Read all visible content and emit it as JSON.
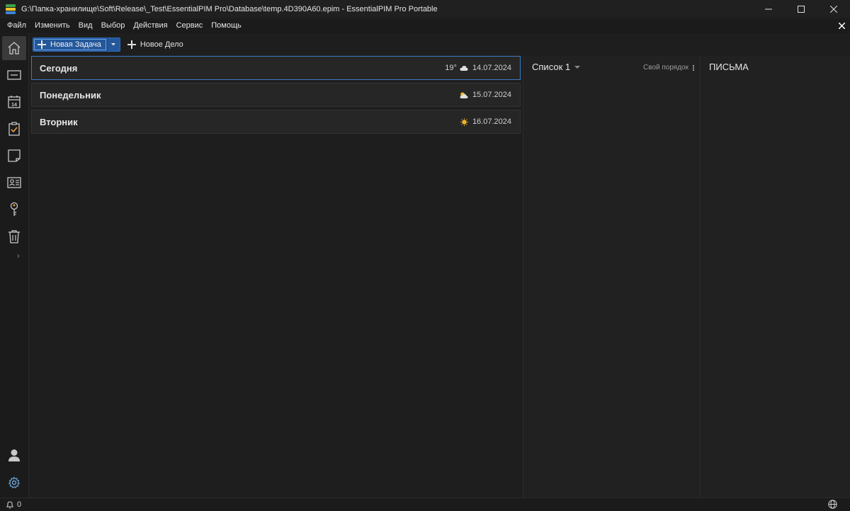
{
  "window": {
    "title": "G:\\Папка-хранилище\\Soft\\Release\\_Test\\EssentialPIM Pro\\Database\\temp.4D390A60.epim - EssentialPIM Pro Portable",
    "icon": "app-stack-icon",
    "controls": [
      "minimize-icon",
      "maximize-icon",
      "close-icon"
    ]
  },
  "menu": {
    "items": [
      "Файл",
      "Изменить",
      "Вид",
      "Выбор",
      "Действия",
      "Сервис",
      "Помощь"
    ],
    "close_icon": "close-icon"
  },
  "toolbar": {
    "new_task": "Новая Задача",
    "new_case": "Новое Дело"
  },
  "nav": {
    "items": [
      "home-icon",
      "mail-icon",
      "calendar-icon",
      "tasks-icon",
      "notes-icon",
      "contacts-icon",
      "passwords-icon",
      "trash-icon"
    ],
    "calendar_day": "14",
    "bottom": [
      "user-icon",
      "settings-icon"
    ]
  },
  "days": [
    {
      "name": "Сегодня",
      "temp": "19°",
      "weather": "cloud-icon",
      "date": "14.07.2024",
      "selected": true
    },
    {
      "name": "Понедельник",
      "temp": "",
      "weather": "partly-cloudy-icon",
      "date": "15.07.2024",
      "selected": false
    },
    {
      "name": "Вторник",
      "temp": "",
      "weather": "sun-icon",
      "date": "16.07.2024",
      "selected": false
    }
  ],
  "list": {
    "title": "Список 1",
    "sort": "Свой порядок"
  },
  "mail": {
    "title": "ПИСЬМА"
  },
  "status": {
    "notifications": "0"
  },
  "colors": {
    "accent": "#2f6db5",
    "selection_border": "#3b7cc4",
    "sun": "#f0b429"
  }
}
